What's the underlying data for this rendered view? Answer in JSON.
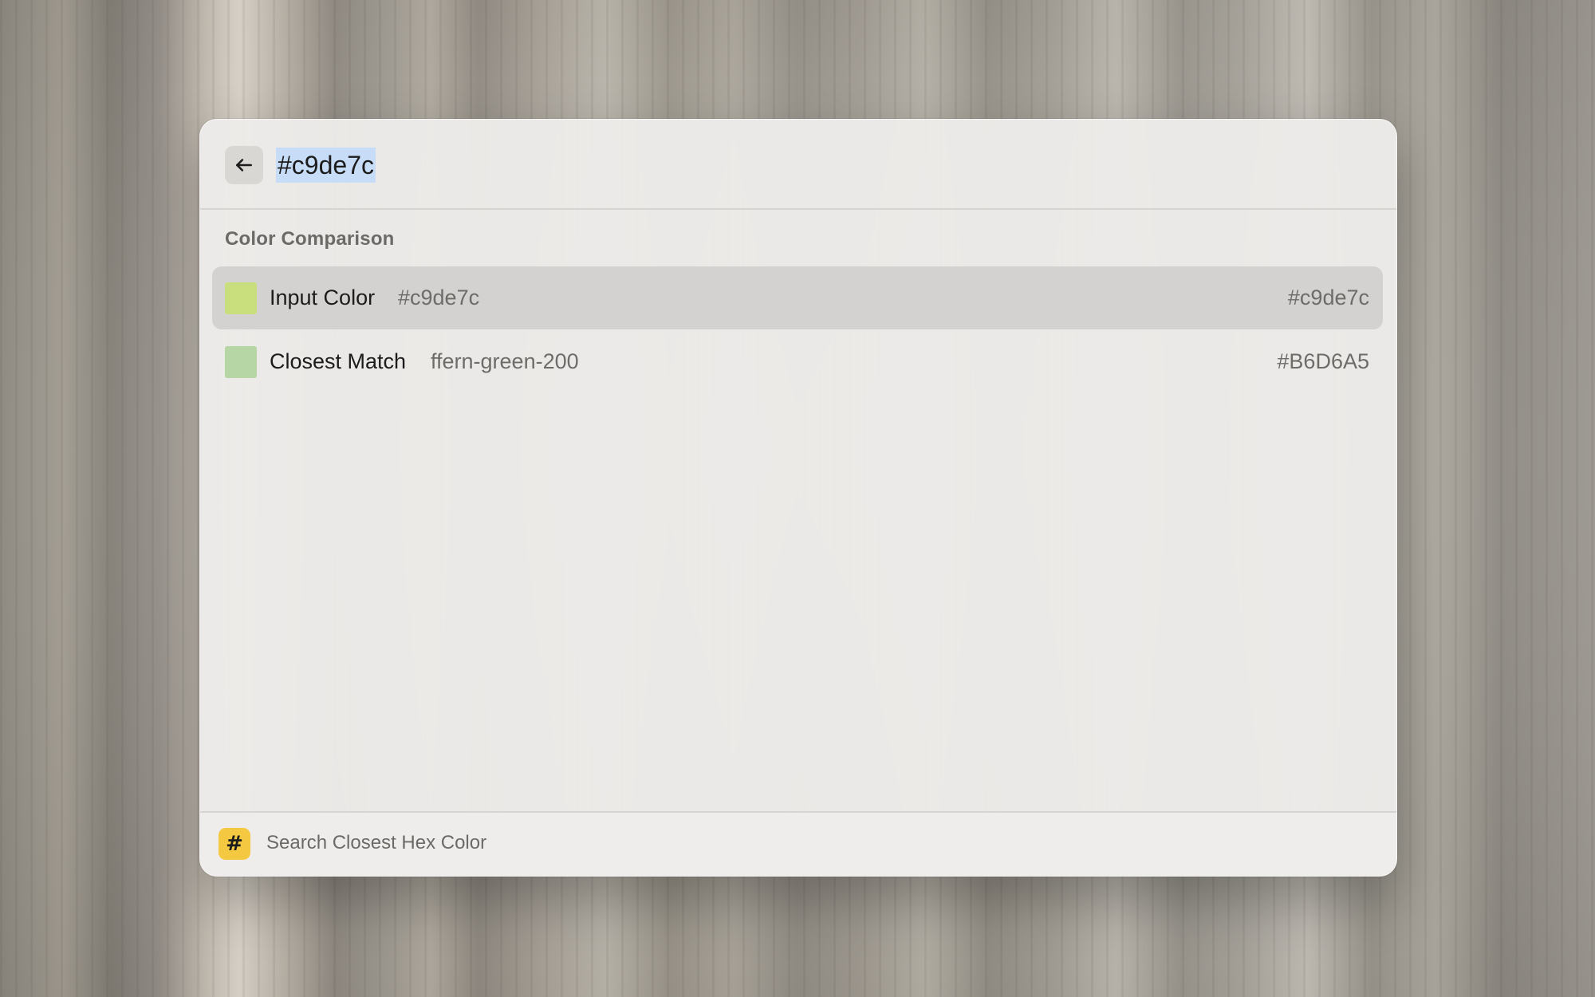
{
  "search": {
    "query": "#c9de7c"
  },
  "section": {
    "title": "Color Comparison"
  },
  "rows": [
    {
      "title": "Input Color",
      "subtitle": "#c9de7c",
      "accessory": "#c9de7c",
      "swatch_color": "#c9de7c",
      "selected": true
    },
    {
      "title": "Closest Match",
      "subtitle": "ffern-green-200",
      "accessory": "#B6D6A5",
      "swatch_color": "#B6D6A5",
      "selected": false
    }
  ],
  "footer": {
    "icon": "hash-icon",
    "icon_glyph": "#",
    "icon_color": "#f5c842",
    "label": "Search Closest Hex Color"
  }
}
